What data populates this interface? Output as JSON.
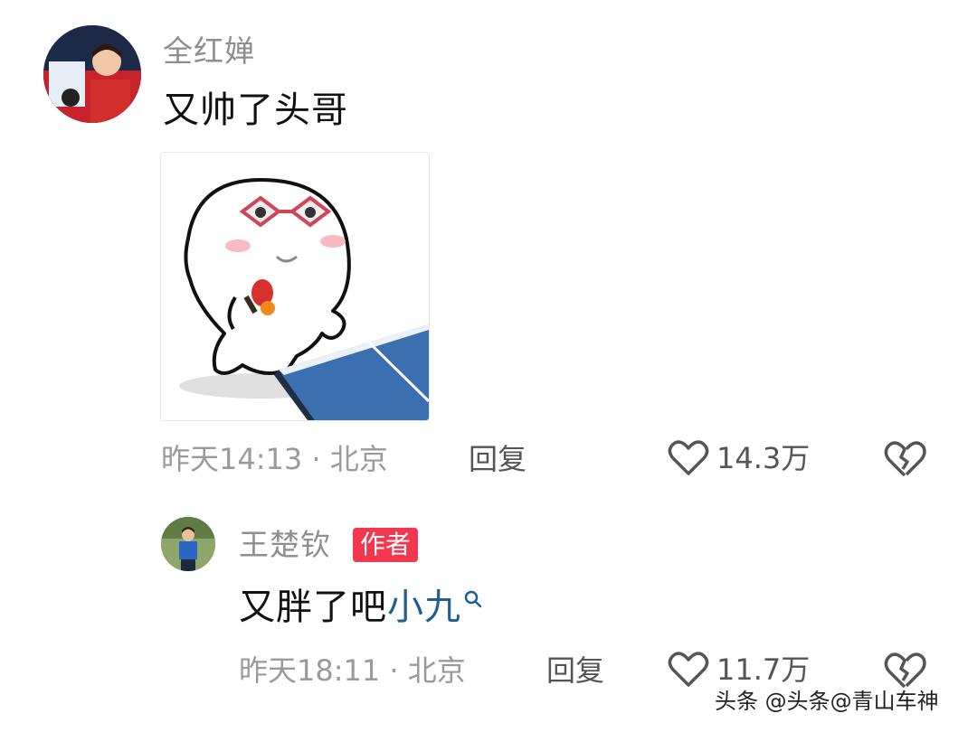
{
  "comment": {
    "username": "全红婵",
    "text": "又帅了头哥",
    "meta": "昨天14:13 · 北京",
    "reply_label": "回复",
    "like_count": "14.3万"
  },
  "reply": {
    "username": "王楚钦",
    "author_badge": "作者",
    "text_prefix": "又胖了吧",
    "mention": "小九",
    "meta": "昨天18:11 · 北京",
    "reply_label": "回复",
    "like_count": "11.7万"
  },
  "watermark": "头条 @头条@青山车神",
  "colors": {
    "author_badge": "#f2374f",
    "mention": "#1f5f8f",
    "meta": "#9a9a9a",
    "table": "#3a6fb0"
  },
  "icons": {
    "like": "heart-outline-icon",
    "dislike": "broken-heart-icon",
    "search_hint": "search-icon"
  }
}
